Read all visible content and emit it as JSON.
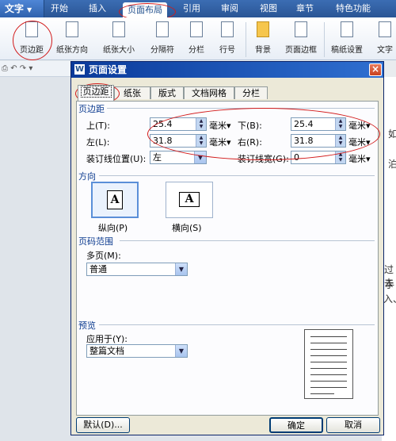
{
  "app": {
    "name": "文字",
    "tabs": [
      "开始",
      "插入",
      "页面布局",
      "引用",
      "审阅",
      "视图",
      "章节",
      "特色功能"
    ],
    "active_tab": "页面布局"
  },
  "ribbon": {
    "items": [
      {
        "label": "页边距"
      },
      {
        "label": "纸张方向"
      },
      {
        "label": "纸张大小"
      },
      {
        "label": "分隔符"
      },
      {
        "label": "分栏"
      },
      {
        "label": "行号"
      },
      {
        "label": "背景"
      },
      {
        "label": "页面边框"
      },
      {
        "label": "稿纸设置"
      },
      {
        "label": "文字"
      }
    ]
  },
  "doc": {
    "fragments": [
      "如",
      "泊",
      "过去",
      "手",
      "入、"
    ]
  },
  "dialog": {
    "title": "页面设置",
    "close": "×",
    "tabs": [
      "页边距",
      "纸张",
      "版式",
      "文档网格",
      "分栏"
    ],
    "margins": {
      "section": "页边距",
      "top_label": "上(T):",
      "top_value": "25.4",
      "bottom_label": "下(B):",
      "bottom_value": "25.4",
      "left_label": "左(L):",
      "left_value": "31.8",
      "right_label": "右(R):",
      "right_value": "31.8",
      "gutter_pos_label": "装订线位置(U):",
      "gutter_pos_value": "左",
      "gutter_width_label": "装订线宽(G):",
      "gutter_width_value": "0",
      "unit": "毫米"
    },
    "orientation": {
      "section": "方向",
      "portrait_label": "纵向(P)",
      "landscape_label": "横向(S)",
      "glyph": "A"
    },
    "page_range": {
      "section": "页码范围",
      "multi_label": "多页(M):",
      "multi_value": "普通"
    },
    "preview": {
      "section": "预览",
      "apply_label": "应用于(Y):",
      "apply_value": "整篇文档"
    },
    "buttons": {
      "default": "默认(D)...",
      "ok": "确定",
      "cancel": "取消"
    }
  }
}
